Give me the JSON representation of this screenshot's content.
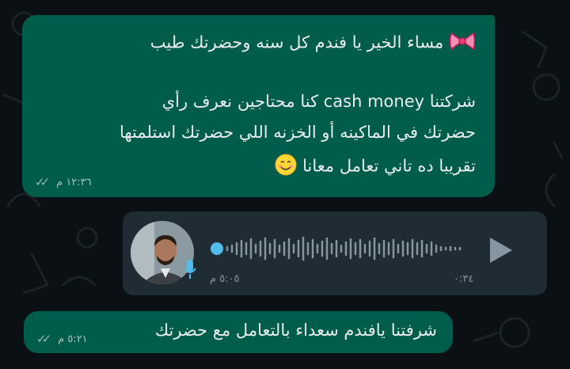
{
  "chat": {
    "message1": {
      "line1": "مساء الخير يا فندم كل سنه وحضرتك طيب",
      "line2": "شركتنا cash money  كنا محتاجين نعرف رأي",
      "line3": "حضرتك في الماكينه أو الخزنه اللي حضرتك استلمتها",
      "line4": "تقريبا ده تاني تعامل معانا",
      "emoji1": "bow-emoji",
      "emoji2": "smiling-face-emoji",
      "time": "١٢:٣٦ م"
    },
    "voice_note": {
      "duration": "٠:٣٤",
      "time": "٥:٠٥ م",
      "icons": [
        "play-icon",
        "mic-icon",
        "avatar"
      ]
    },
    "message2": {
      "text": "شرفتنا يافندم سعداء بالتعامل مع حضرتك",
      "time": "٥:٢١ م"
    }
  },
  "colors": {
    "outgoing_bubble": "#005c4b",
    "incoming_bubble": "#1f2c34",
    "background": "#0b1014",
    "accent_blue": "#53bdeb"
  }
}
